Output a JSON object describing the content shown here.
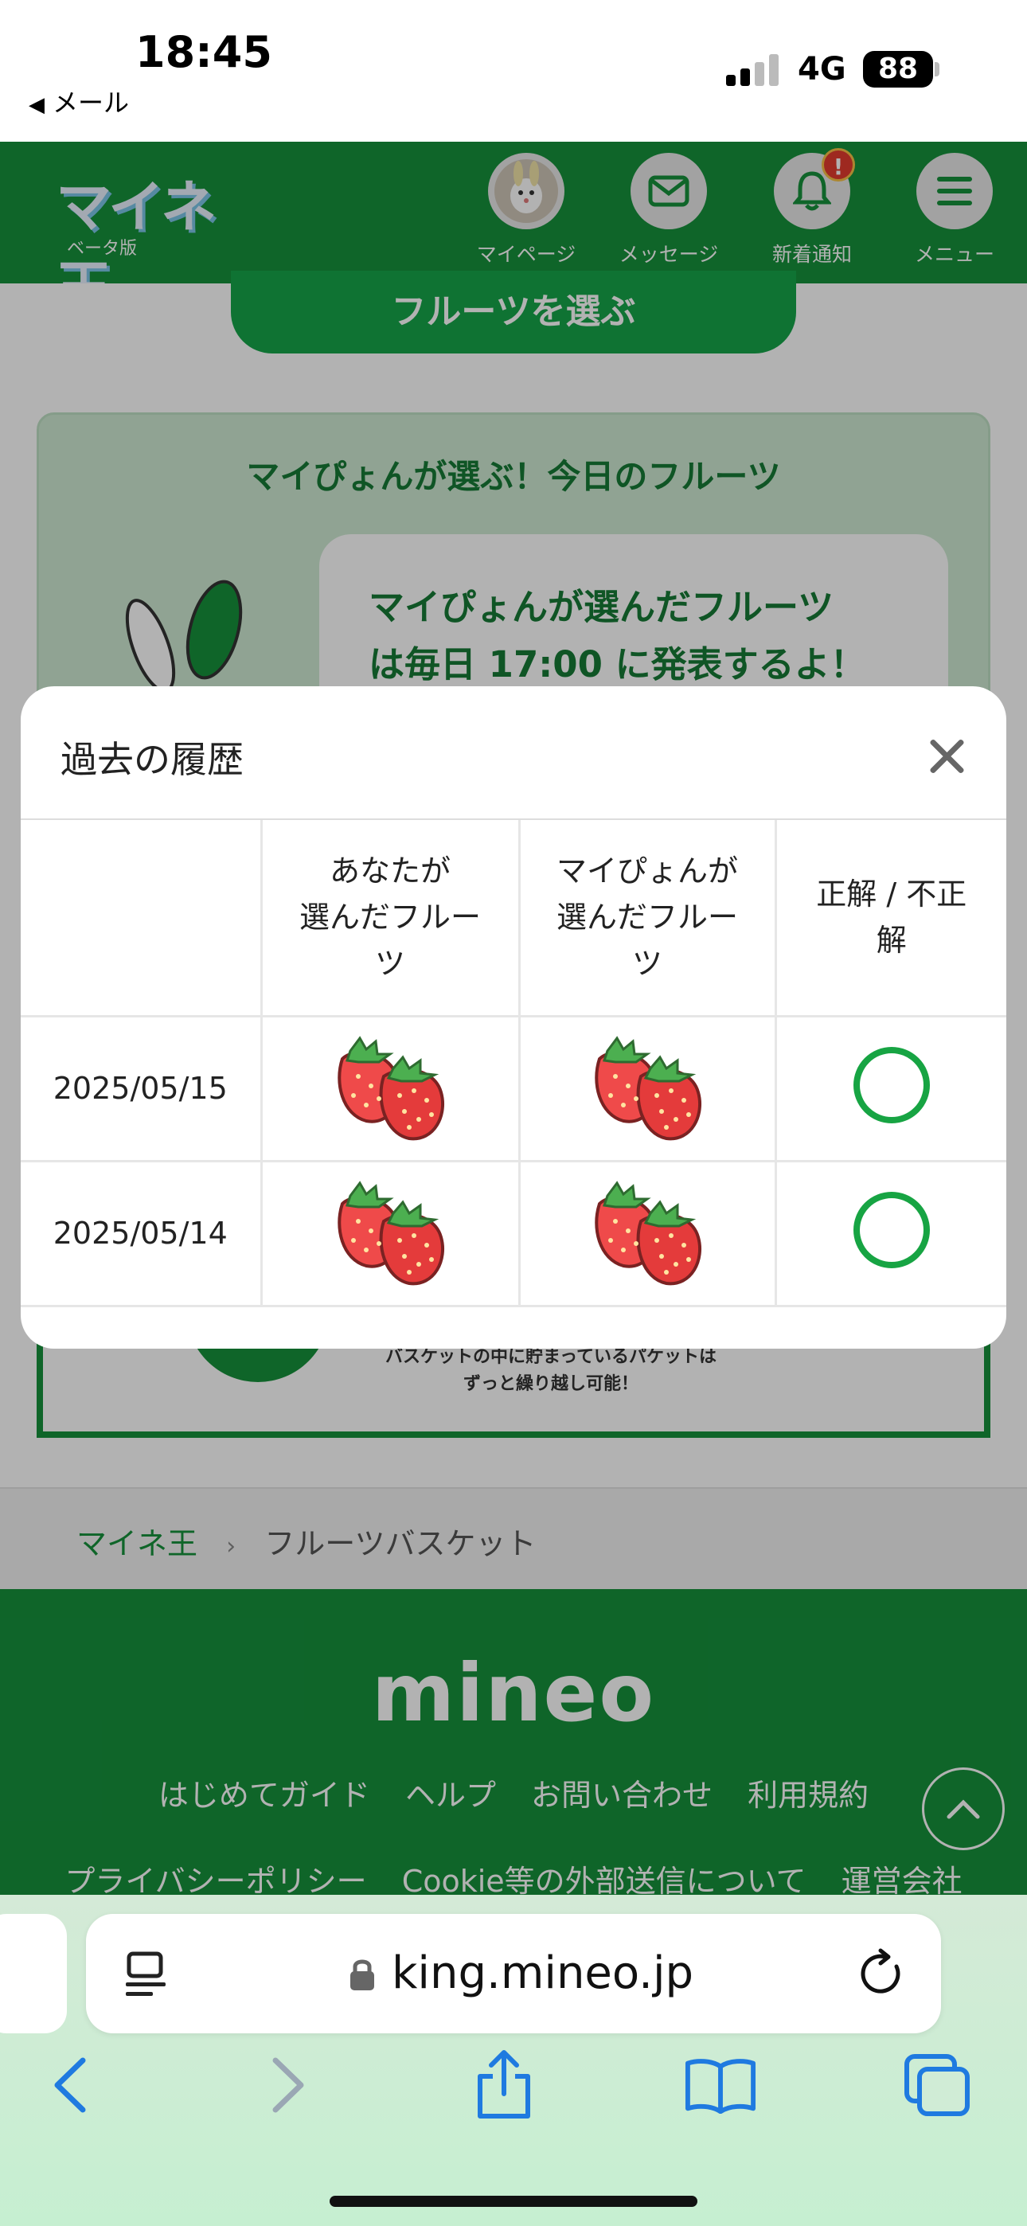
{
  "status_bar": {
    "time": "18:45",
    "back_app": "メール",
    "network": "4G",
    "battery": "88"
  },
  "header": {
    "logo": "マイネ王",
    "logo_sub": "ベータ版",
    "nav": [
      {
        "label": "マイページ",
        "icon": "avatar"
      },
      {
        "label": "メッセージ",
        "icon": "envelope-icon"
      },
      {
        "label": "新着通知",
        "icon": "bell-icon",
        "badge": "!"
      },
      {
        "label": "メニュー",
        "icon": "hamburger-icon"
      }
    ]
  },
  "page": {
    "choose_button": "フルーツを選ぶ",
    "card_title": "マイぴょんが選ぶ！今日のフルーツ",
    "bubble_line1": "マイぴょんが選んだフルーツ",
    "bubble_line2": "は毎日 17:00 に発表するよ！",
    "banner_line1": "バスケットの中に貯まっているパケットは",
    "banner_line2": "ずっと繰り越し可能！"
  },
  "breadcrumb": {
    "home": "マイネ王",
    "current": "フルーツバスケット"
  },
  "footer": {
    "logo": "mineo",
    "links_row1": [
      "はじめてガイド",
      "ヘルプ",
      "お問い合わせ",
      "利用規約"
    ],
    "links_row2": [
      "プライバシーポリシー",
      "Cookie等の外部送信について",
      "運営会社"
    ]
  },
  "modal": {
    "title": "過去の履歴",
    "columns": [
      "",
      "あなたが\n選んだフルー\nツ",
      "マイぴょんが\n選んだフルー\nツ",
      "正解 / 不正\n解"
    ],
    "col_you_l1": "あなたが",
    "col_you_l2": "選んだフルー",
    "col_you_l3": "ツ",
    "col_mai_l1": "マイぴょんが",
    "col_mai_l2": "選んだフルー",
    "col_mai_l3": "ツ",
    "col_res_l1": "正解 / 不正",
    "col_res_l2": "解",
    "rows": [
      {
        "date": "2025/05/15",
        "you": "strawberry",
        "mai": "strawberry",
        "result": "correct"
      },
      {
        "date": "2025/05/14",
        "you": "strawberry",
        "mai": "strawberry",
        "result": "correct"
      }
    ]
  },
  "browser": {
    "url": "king.mineo.jp"
  },
  "colors": {
    "brand_green": "#16913c",
    "correct_green": "#17a443",
    "notif_red": "#e23c2f"
  }
}
